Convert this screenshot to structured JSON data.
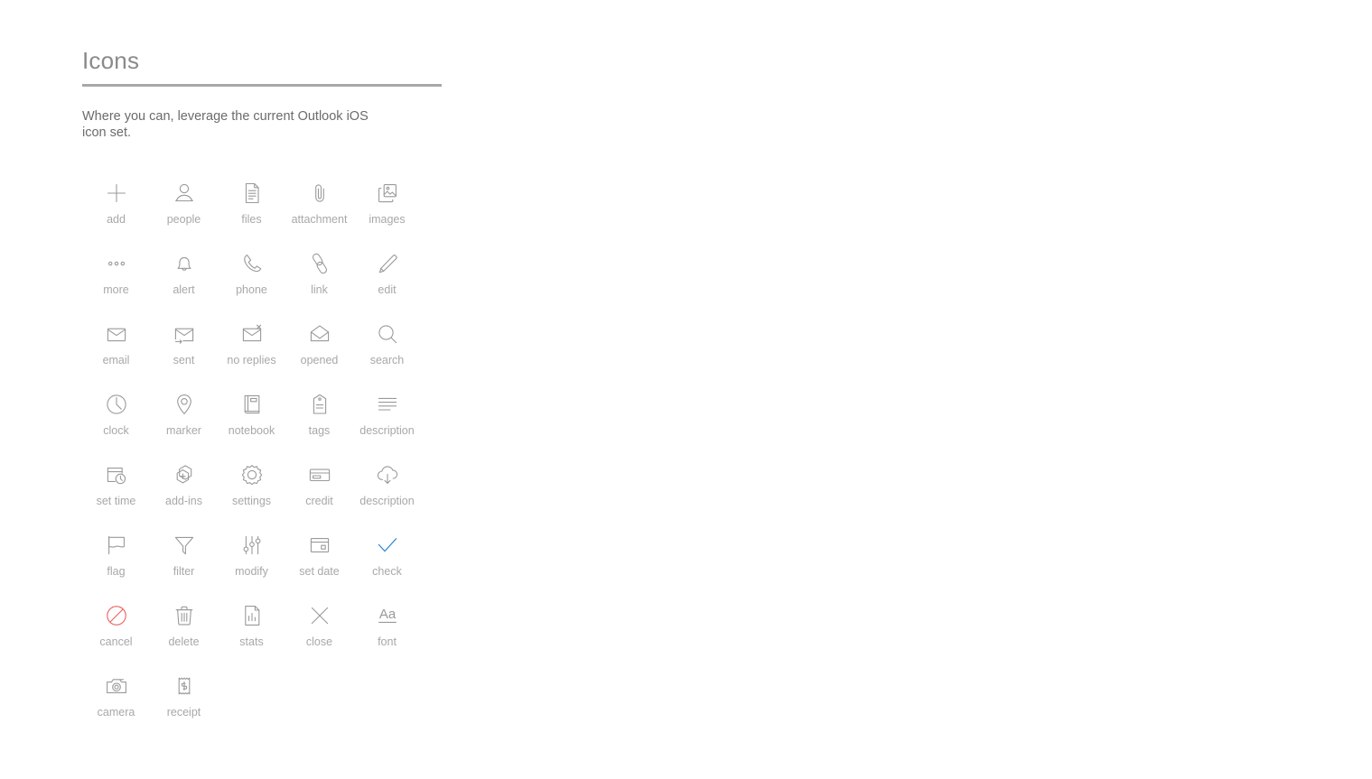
{
  "page": {
    "title": "Icons",
    "description": "Where you can, leverage the current Outlook iOS icon set."
  },
  "colors": {
    "icon_stroke": "#9a9a9a",
    "label_text": "#a8a8a8",
    "title_text": "#8a8a8a",
    "rule": "#a8a8a8",
    "accent_blue": "#1a7fd4",
    "accent_red": "#e8605f"
  },
  "icons": [
    {
      "name": "add-icon",
      "label": "add",
      "color": "default"
    },
    {
      "name": "people-icon",
      "label": "people",
      "color": "default"
    },
    {
      "name": "files-icon",
      "label": "files",
      "color": "default"
    },
    {
      "name": "attachment-icon",
      "label": "attachment",
      "color": "default"
    },
    {
      "name": "images-icon",
      "label": "images",
      "color": "default"
    },
    {
      "name": "more-icon",
      "label": "more",
      "color": "default"
    },
    {
      "name": "alert-icon",
      "label": "alert",
      "color": "default"
    },
    {
      "name": "phone-icon",
      "label": "phone",
      "color": "default"
    },
    {
      "name": "link-icon",
      "label": "link",
      "color": "default"
    },
    {
      "name": "edit-icon",
      "label": "edit",
      "color": "default"
    },
    {
      "name": "email-icon",
      "label": "email",
      "color": "default"
    },
    {
      "name": "sent-icon",
      "label": "sent",
      "color": "default"
    },
    {
      "name": "no-replies-icon",
      "label": "no replies",
      "color": "default"
    },
    {
      "name": "opened-icon",
      "label": "opened",
      "color": "default"
    },
    {
      "name": "search-icon",
      "label": "search",
      "color": "default"
    },
    {
      "name": "clock-icon",
      "label": "clock",
      "color": "default"
    },
    {
      "name": "marker-icon",
      "label": "marker",
      "color": "default"
    },
    {
      "name": "notebook-icon",
      "label": "notebook",
      "color": "default"
    },
    {
      "name": "tags-icon",
      "label": "tags",
      "color": "default"
    },
    {
      "name": "description-icon",
      "label": "description",
      "color": "default"
    },
    {
      "name": "set-time-icon",
      "label": "set time",
      "color": "default"
    },
    {
      "name": "add-ins-icon",
      "label": "add-ins",
      "color": "default"
    },
    {
      "name": "settings-icon",
      "label": "settings",
      "color": "default"
    },
    {
      "name": "credit-icon",
      "label": "credit",
      "color": "default"
    },
    {
      "name": "cloud-download-description-icon",
      "label": "description",
      "color": "default"
    },
    {
      "name": "flag-icon",
      "label": "flag",
      "color": "default"
    },
    {
      "name": "filter-icon",
      "label": "filter",
      "color": "default"
    },
    {
      "name": "modify-icon",
      "label": "modify",
      "color": "default"
    },
    {
      "name": "set-date-icon",
      "label": "set date",
      "color": "default"
    },
    {
      "name": "check-icon",
      "label": "check",
      "color": "blue"
    },
    {
      "name": "cancel-icon",
      "label": "cancel",
      "color": "red"
    },
    {
      "name": "delete-icon",
      "label": "delete",
      "color": "default"
    },
    {
      "name": "stats-icon",
      "label": "stats",
      "color": "default"
    },
    {
      "name": "close-icon",
      "label": "close",
      "color": "default"
    },
    {
      "name": "font-icon",
      "label": "font",
      "color": "default"
    },
    {
      "name": "camera-icon",
      "label": "camera",
      "color": "default"
    },
    {
      "name": "receipt-icon",
      "label": "receipt",
      "color": "default"
    }
  ]
}
